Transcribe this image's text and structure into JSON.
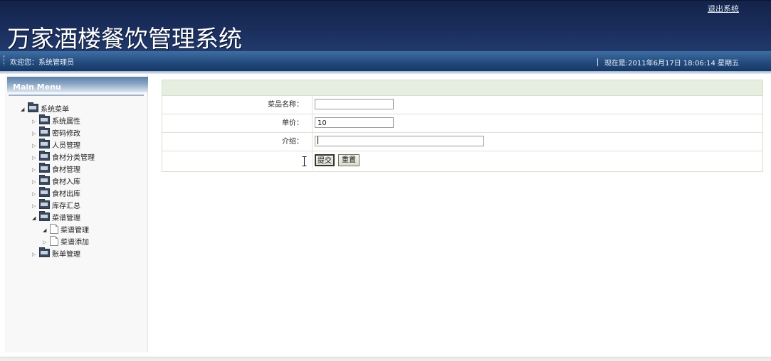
{
  "header": {
    "logout_label": "退出系统",
    "app_title": "万家酒楼餐饮管理系统",
    "welcome_text": "欢迎您：系统管理员",
    "datetime_text": "现在是:2011年6月17日  18:06:14 星期五"
  },
  "sidebar": {
    "menu_title": "Main Menu",
    "root_label": "系统菜单",
    "items": [
      {
        "label": "系统属性"
      },
      {
        "label": "密码修改"
      },
      {
        "label": "人员管理"
      },
      {
        "label": "食材分类管理"
      },
      {
        "label": "食材管理"
      },
      {
        "label": "食材入库"
      },
      {
        "label": "食材出库"
      },
      {
        "label": "库存汇总"
      },
      {
        "label": "菜谱管理"
      },
      {
        "label": "账单管理"
      }
    ],
    "sub_items": [
      {
        "label": "菜谱管理"
      },
      {
        "label": "菜谱添加"
      }
    ]
  },
  "form": {
    "name_label": "菜品名称：",
    "name_value": "",
    "price_label": "单价：",
    "price_value": "10",
    "intro_label": "介绍：",
    "intro_value": "",
    "submit_label": "提交",
    "reset_label": "重置"
  },
  "colors": {
    "header_dark": "#1a2e5c",
    "bar_blue": "#244c7f",
    "form_header_green": "#e6eee1"
  }
}
